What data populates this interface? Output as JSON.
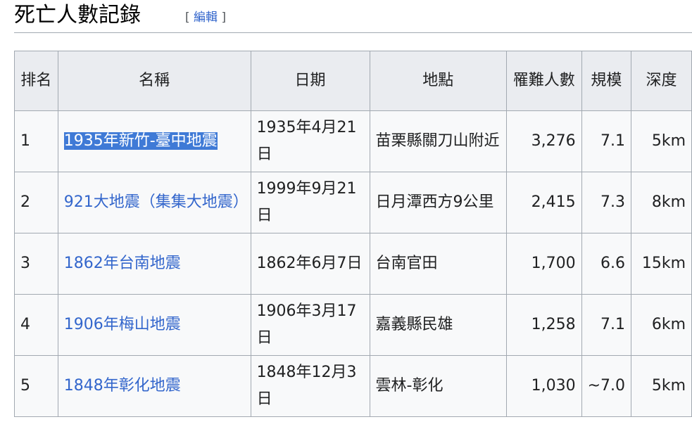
{
  "section": {
    "title": "死亡人數記錄",
    "edit_open": "[",
    "edit_label": "編輯",
    "edit_close": "]"
  },
  "table": {
    "headers": [
      "排名",
      "名稱",
      "日期",
      "地點",
      "罹難人數",
      "規模",
      "深度"
    ],
    "rows": [
      {
        "rank": "1",
        "name": "1935年新竹-臺中地震",
        "date": "1935年4月21日",
        "place": "苗栗縣關刀山附近",
        "deaths": "3,276",
        "scale": "7.1",
        "depth": "5km"
      },
      {
        "rank": "2",
        "name": "921大地震（集集大地震）",
        "date": "1999年9月21日",
        "place": "日月潭西方9公里",
        "deaths": "2,415",
        "scale": "7.3",
        "depth": "8km"
      },
      {
        "rank": "3",
        "name": "1862年台南地震",
        "date": "1862年6月7日",
        "place": "台南官田",
        "deaths": "1,700",
        "scale": "6.6",
        "depth": "15km"
      },
      {
        "rank": "4",
        "name": "1906年梅山地震",
        "date": "1906年3月17日",
        "place": "嘉義縣民雄",
        "deaths": "1,258",
        "scale": "7.1",
        "depth": "6km"
      },
      {
        "rank": "5",
        "name": "1848年彰化地震",
        "date": "1848年12月3日",
        "place": "雲林-彰化",
        "deaths": "1,030",
        "scale": "~7.0",
        "depth": "5km"
      }
    ]
  },
  "colors": {
    "link": "#3366cc",
    "selection": "#3f7ad6",
    "header_bg": "#eaecf0",
    "cell_bg": "#f8f9fa",
    "border": "#a2a9b1"
  }
}
